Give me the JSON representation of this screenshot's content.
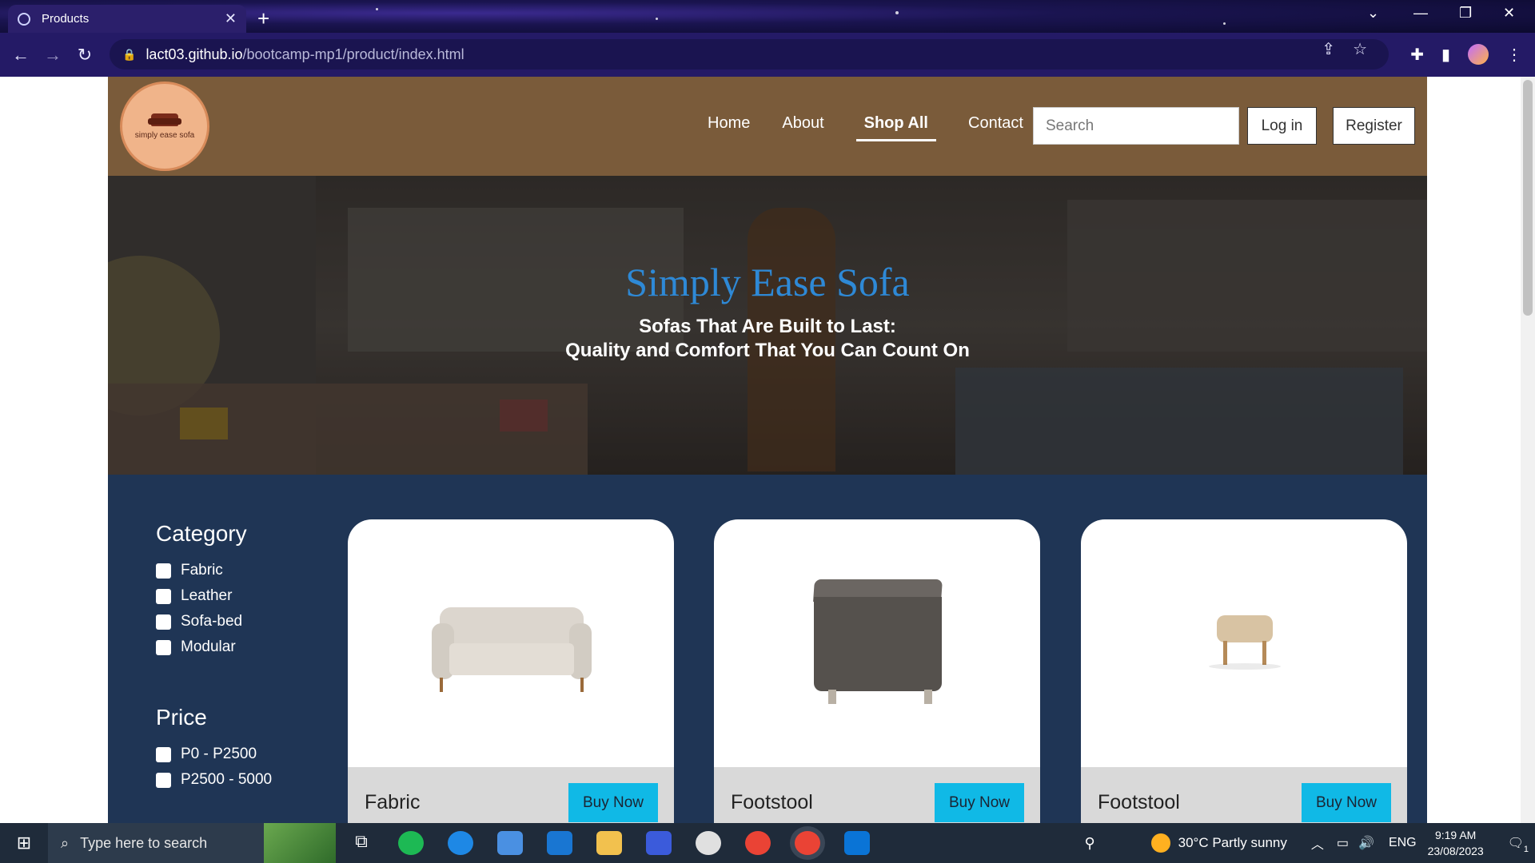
{
  "browser": {
    "tab_title": "Products",
    "url_host": "lact03.github.io",
    "url_path": "/bootcamp-mp1/product/index.html"
  },
  "site": {
    "logo_text": "simply ease sofa",
    "nav": [
      "Home",
      "About",
      "Shop All",
      "Contact"
    ],
    "search_placeholder": "Search",
    "login_label": "Log in",
    "register_label": "Register"
  },
  "hero": {
    "title": "Simply Ease Sofa",
    "subtitle_line1": "Sofas That Are Built to Last:",
    "subtitle_line2": "Quality and Comfort That You Can Count On"
  },
  "filters": {
    "category_heading": "Category",
    "categories": [
      "Fabric",
      "Leather",
      "Sofa-bed",
      "Modular"
    ],
    "price_heading": "Price",
    "prices": [
      "P0 - P2500",
      "P2500 - 5000"
    ]
  },
  "products": [
    {
      "name": "Fabric",
      "button": "Buy Now"
    },
    {
      "name": "Footstool",
      "button": "Buy Now"
    },
    {
      "name": "Footstool",
      "button": "Buy Now"
    }
  ],
  "taskbar": {
    "search_placeholder": "Type here to search",
    "weather": "30°C  Partly sunny",
    "language": "ENG",
    "time": "9:19 AM",
    "date": "23/08/2023",
    "notifications": "1"
  },
  "colors": {
    "header_brown": "#7a5b3a",
    "hero_title_blue": "#2e89d6",
    "products_navy": "#1f3555",
    "buy_button_cyan": "#10b9e6"
  }
}
